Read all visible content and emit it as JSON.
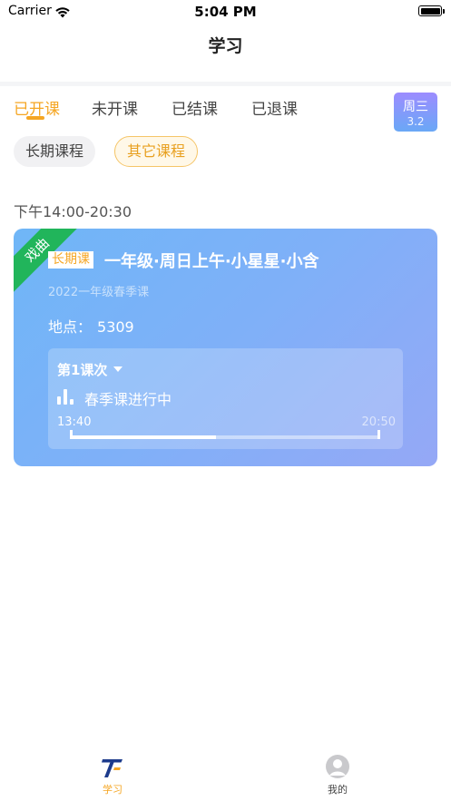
{
  "status_bar": {
    "carrier": "Carrier",
    "time": "5:04 PM"
  },
  "nav": {
    "title": "学习"
  },
  "tabs": {
    "items": [
      {
        "label": "已开课",
        "active": true
      },
      {
        "label": "未开课",
        "active": false
      },
      {
        "label": "已结课",
        "active": false
      },
      {
        "label": "已退课",
        "active": false
      }
    ],
    "date_badge": {
      "weekday": "周三",
      "date": "3.2"
    }
  },
  "filters": {
    "long": "长期课程",
    "other": "其它课程"
  },
  "section": {
    "time_range": "下午14:00-20:30"
  },
  "course_card": {
    "ribbon": "戏曲",
    "tag": "长期课",
    "title": "一年级·周日上午·小星星·小含",
    "subtitle": "2022一年级春季课",
    "location_label": "地点：",
    "location_value": "5309",
    "session": {
      "name": "第1课次",
      "status": "春季课进行中",
      "start_time": "13:40",
      "end_time": "20:50",
      "progress_percent": 47
    }
  },
  "tabbar": {
    "items": [
      {
        "label": "学习",
        "icon": "study-logo-icon",
        "active": true
      },
      {
        "label": "我的",
        "icon": "profile-icon",
        "active": false
      }
    ]
  },
  "colors": {
    "accent": "#f5a623",
    "ribbon": "#21b55b",
    "card_gradient_start": "#6fb6f7",
    "card_gradient_end": "#95a8f6",
    "tabbar_logo_blue": "#1d3b8c"
  }
}
